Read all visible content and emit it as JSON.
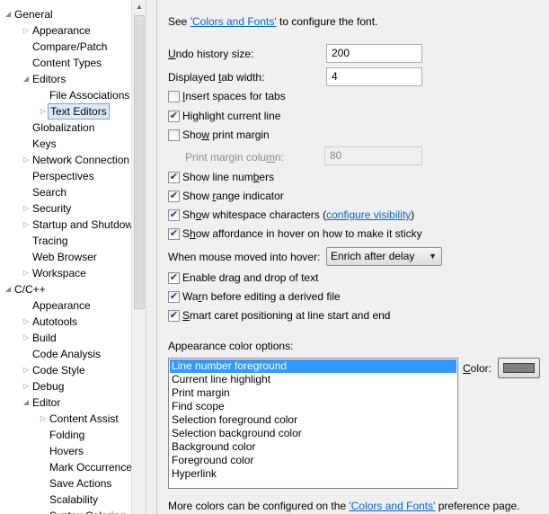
{
  "tree": {
    "nodes": [
      {
        "label": "General",
        "expander": "expanded",
        "indent": 0
      },
      {
        "label": "Appearance",
        "expander": "collapsed",
        "indent": 1
      },
      {
        "label": "Compare/Patch",
        "expander": "none",
        "indent": 1
      },
      {
        "label": "Content Types",
        "expander": "none",
        "indent": 1
      },
      {
        "label": "Editors",
        "expander": "expanded",
        "indent": 1
      },
      {
        "label": "File Associations",
        "expander": "none",
        "indent": 2
      },
      {
        "label": "Text Editors",
        "expander": "collapsed",
        "indent": 2,
        "selected": true
      },
      {
        "label": "Globalization",
        "expander": "none",
        "indent": 1
      },
      {
        "label": "Keys",
        "expander": "none",
        "indent": 1
      },
      {
        "label": "Network Connection",
        "expander": "collapsed",
        "indent": 1
      },
      {
        "label": "Perspectives",
        "expander": "none",
        "indent": 1
      },
      {
        "label": "Search",
        "expander": "none",
        "indent": 1
      },
      {
        "label": "Security",
        "expander": "collapsed",
        "indent": 1
      },
      {
        "label": "Startup and Shutdow",
        "expander": "collapsed",
        "indent": 1
      },
      {
        "label": "Tracing",
        "expander": "none",
        "indent": 1
      },
      {
        "label": "Web Browser",
        "expander": "none",
        "indent": 1
      },
      {
        "label": "Workspace",
        "expander": "collapsed",
        "indent": 1
      },
      {
        "label": "C/C++",
        "expander": "expanded",
        "indent": 0
      },
      {
        "label": "Appearance",
        "expander": "none",
        "indent": 1
      },
      {
        "label": "Autotools",
        "expander": "collapsed",
        "indent": 1
      },
      {
        "label": "Build",
        "expander": "collapsed",
        "indent": 1
      },
      {
        "label": "Code Analysis",
        "expander": "none",
        "indent": 1
      },
      {
        "label": "Code Style",
        "expander": "collapsed",
        "indent": 1
      },
      {
        "label": "Debug",
        "expander": "collapsed",
        "indent": 1
      },
      {
        "label": "Editor",
        "expander": "expanded",
        "indent": 1
      },
      {
        "label": "Content Assist",
        "expander": "collapsed",
        "indent": 2
      },
      {
        "label": "Folding",
        "expander": "none",
        "indent": 2
      },
      {
        "label": "Hovers",
        "expander": "none",
        "indent": 2
      },
      {
        "label": "Mark Occurrence",
        "expander": "none",
        "indent": 2
      },
      {
        "label": "Save Actions",
        "expander": "none",
        "indent": 2
      },
      {
        "label": "Scalability",
        "expander": "none",
        "indent": 2
      },
      {
        "label": "Syntax Coloring",
        "expander": "none",
        "indent": 2
      }
    ]
  },
  "page": {
    "intro_prefix": "See ",
    "intro_link": "'Colors and Fonts'",
    "intro_suffix": " to configure the font.",
    "undo_label": "Undo history size:",
    "undo_value": "200",
    "tab_label": "Displayed tab width:",
    "tab_value": "4",
    "insert_spaces": {
      "label": "Insert spaces for tabs",
      "checked": false
    },
    "highlight_line": {
      "label": "Highlight current line",
      "checked": true
    },
    "show_print_margin": {
      "label": "Show print margin",
      "checked": false
    },
    "print_margin_label": "Print margin column:",
    "print_margin_value": "80",
    "show_line_numbers": {
      "label": "Show line numbers",
      "checked": true
    },
    "show_range": {
      "label": "Show range indicator",
      "checked": true
    },
    "show_whitespace": {
      "label": "Show whitespace characters (",
      "link": "configure visibility",
      "suffix": ")",
      "checked": true
    },
    "show_affordance": {
      "label": "Show affordance in hover on how to make it sticky",
      "checked": true
    },
    "hover_label": "When mouse moved into hover:",
    "hover_value": "Enrich after delay",
    "drag_drop": {
      "label": "Enable drag and drop of text",
      "checked": true
    },
    "warn_derived": {
      "label": "Warn before editing a derived file",
      "checked": true
    },
    "smart_caret": {
      "label": "Smart caret positioning at line start and end",
      "checked": true
    },
    "appearance_title": "Appearance color options:",
    "color_label": "Color:",
    "color_value": "#808080",
    "color_options": [
      "Line number foreground",
      "Current line highlight",
      "Print margin",
      "Find scope",
      "Selection foreground color",
      "Selection background color",
      "Background color",
      "Foreground color",
      "Hyperlink"
    ],
    "selected_color_option": 0,
    "footer_prefix": "More colors can be configured on the ",
    "footer_link": "'Colors and Fonts'",
    "footer_suffix": " preference page."
  }
}
